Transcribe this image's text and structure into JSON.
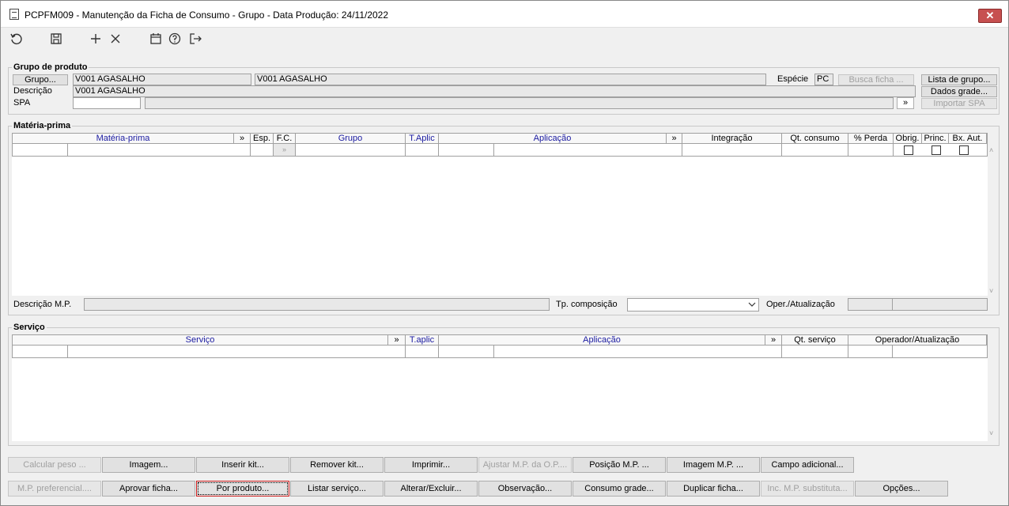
{
  "window": {
    "title": "PCPFM009 - Manutenção da Ficha de Consumo - Grupo - Data Produção: 24/11/2022",
    "close_label": "✕"
  },
  "toolbar": {
    "icons": [
      "refresh-icon",
      "save-icon",
      "add-icon",
      "delete-icon",
      "calendar-icon",
      "help-icon",
      "exit-icon"
    ]
  },
  "grupo": {
    "legend": "Grupo de produto",
    "grupo_btn": "Grupo...",
    "grupo_code": "V001 AGASALHO",
    "grupo_name": "V001 AGASALHO",
    "descricao_label": "Descrição",
    "descricao_value": "V001 AGASALHO",
    "spa_label": "SPA",
    "spa_value": "",
    "spa_desc": "",
    "especie_label": "Espécie",
    "especie_value": "PC",
    "busca_ficha": "Busca ficha ...",
    "lista_grupo": "Lista de grupo...",
    "dados_grade": "Dados grade...",
    "importar_spa": "Importar SPA",
    "more_label": "»"
  },
  "materia": {
    "legend": "Matéria-prima",
    "headers": {
      "materia": "Matéria-prima",
      "more1": "»",
      "esp": "Esp.",
      "fc": "F.C.",
      "grupo": "Grupo",
      "taplic": "T.Aplic",
      "aplicacao": "Aplicação",
      "more2": "»",
      "integracao": "Integração",
      "qtconsumo": "Qt. consumo",
      "perda": "% Perda",
      "obrig": "Obrig.",
      "princ": "Princ.",
      "bxaut": "Bx. Aut."
    },
    "fc_cell": "»",
    "descricao_mp_label": "Descrição M.P.",
    "descricao_mp_value": "",
    "tp_composicao_label": "Tp. composição",
    "tp_composicao_value": "",
    "oper_label": "Oper./Atualização"
  },
  "servico": {
    "legend": "Serviço",
    "headers": {
      "servico": "Serviço",
      "more1": "»",
      "taplic": "T.aplic",
      "aplicacao": "Aplicação",
      "more2": "»",
      "qtservico": "Qt. serviço",
      "operador": "Operador/Atualização"
    }
  },
  "buttons_row1": [
    {
      "label": "Calcular peso ...",
      "disabled": true
    },
    {
      "label": "Imagem...",
      "disabled": false
    },
    {
      "label": "Inserir kit...",
      "disabled": false
    },
    {
      "label": "Remover kit...",
      "disabled": false
    },
    {
      "label": "Imprimir...",
      "disabled": false
    },
    {
      "label": "Ajustar M.P. da O.P....",
      "disabled": true
    },
    {
      "label": "Posição M.P. ...",
      "disabled": false
    },
    {
      "label": "Imagem M.P. ...",
      "disabled": false
    },
    {
      "label": "Campo adicional...",
      "disabled": false
    }
  ],
  "buttons_row2": [
    {
      "label": "M.P. preferencial....",
      "disabled": true
    },
    {
      "label": "Aprovar ficha...",
      "disabled": false
    },
    {
      "label": "Por produto...",
      "disabled": false,
      "focused": true
    },
    {
      "label": "Listar serviço...",
      "disabled": false
    },
    {
      "label": "Alterar/Excluir...",
      "disabled": false
    },
    {
      "label": "Observação...",
      "disabled": false
    },
    {
      "label": "Consumo grade...",
      "disabled": false
    },
    {
      "label": "Duplicar ficha...",
      "disabled": false
    },
    {
      "label": "Inc. M.P. substituta...",
      "disabled": true
    },
    {
      "label": "Opções...",
      "disabled": false
    }
  ]
}
